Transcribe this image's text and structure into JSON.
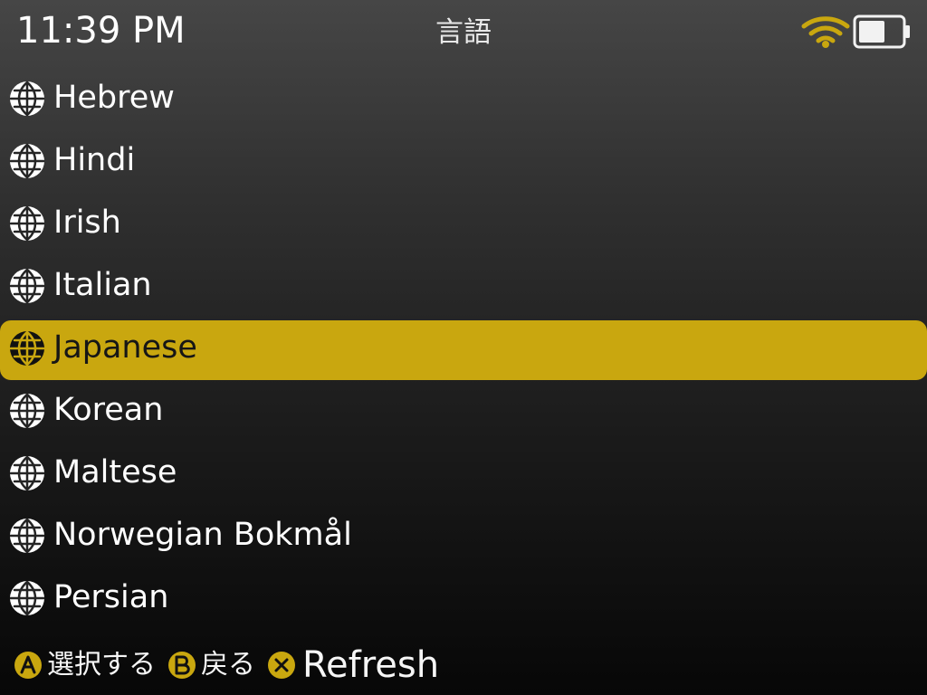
{
  "status_bar": {
    "time": "11:39 PM",
    "title": "言語",
    "wifi_icon": "wifi-icon",
    "battery_icon": "battery-icon",
    "accent_color": "#c9a70f"
  },
  "languages": {
    "items": [
      {
        "label": "Hebrew",
        "icon": "globe-icon"
      },
      {
        "label": "Hindi",
        "icon": "globe-icon"
      },
      {
        "label": "Irish",
        "icon": "globe-icon"
      },
      {
        "label": "Italian",
        "icon": "globe-icon"
      },
      {
        "label": "Japanese",
        "icon": "globe-icon",
        "selected": true
      },
      {
        "label": "Korean",
        "icon": "globe-icon"
      },
      {
        "label": "Maltese",
        "icon": "globe-icon"
      },
      {
        "label": "Norwegian Bokmål",
        "icon": "globe-icon"
      },
      {
        "label": "Persian",
        "icon": "globe-icon"
      }
    ],
    "selected_color": "#c9a70f"
  },
  "footer": {
    "actions": [
      {
        "button": "A",
        "label": "選択する",
        "icon": "a-button-icon"
      },
      {
        "button": "B",
        "label": "戻る",
        "icon": "b-button-icon"
      },
      {
        "button": "X",
        "label": "Refresh",
        "icon": "x-button-icon"
      }
    ]
  }
}
